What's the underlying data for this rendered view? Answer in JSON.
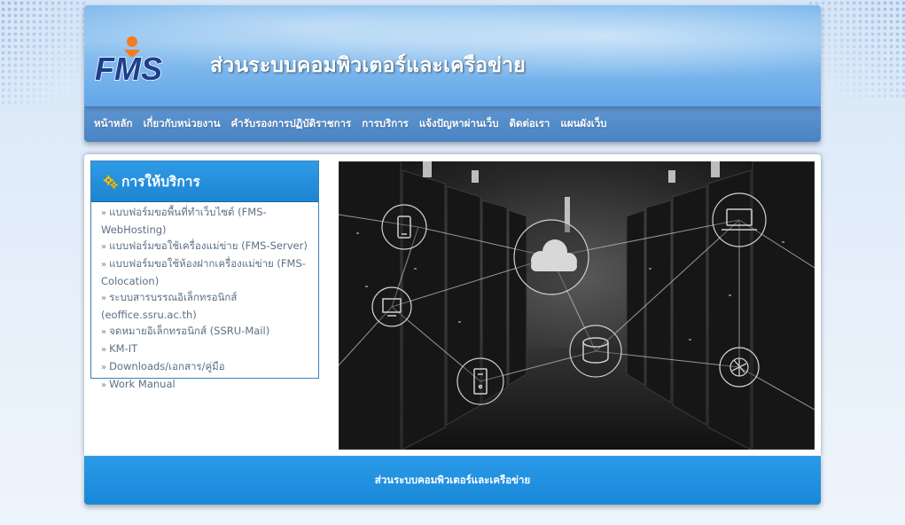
{
  "header": {
    "logo_text": "FMS",
    "title": "ส่วนระบบคอมพิวเตอร์และเครือข่าย"
  },
  "nav": {
    "items": [
      {
        "label": "หน้าหลัก"
      },
      {
        "label": "เกี่ยวกับหน่วยงาน"
      },
      {
        "label": "คำรับรองการปฏิบัติราชการ"
      },
      {
        "label": "การบริการ"
      },
      {
        "label": "แจ้งปัญหาผ่านเว็บ"
      },
      {
        "label": "ติดต่อเรา"
      },
      {
        "label": "แผนผังเว็บ"
      }
    ]
  },
  "services": {
    "title": "การให้บริการ",
    "icon": "gear-icon",
    "items": [
      {
        "label": "แบบฟอร์มขอพื้นที่ทำเว็บไซต์ (FMS-WebHosting)"
      },
      {
        "label": "แบบฟอร์มขอใช้เครื่องแม่ข่าย (FMS-Server)"
      },
      {
        "label": "แบบฟอร์มขอใช้ห้องฝากเครื่องแม่ข่าย (FMS-Colocation)"
      },
      {
        "label": "ระบบสารบรรณอิเล็กทรอนิกส์ (eoffice.ssru.ac.th)"
      },
      {
        "label": "จดหมายอิเล็กทรอนิกส์ (SSRU-Mail)"
      },
      {
        "label": "KM-IT"
      },
      {
        "label": "Downloads/เอกสาร/คู่มือ"
      },
      {
        "label": "Work Manual"
      }
    ]
  },
  "hero": {
    "icons": [
      "cloud-icon",
      "tablet-icon",
      "laptop-icon",
      "monitor-icon",
      "database-icon",
      "server-icon",
      "aperture-icon"
    ]
  },
  "footer": {
    "text": "ส่วนระบบคอมพิวเตอร์และเครือข่าย"
  },
  "colors": {
    "nav_bg": "#4a84c4",
    "accent_blue": "#1d84d2",
    "logo_blue": "#1d3f8c",
    "logo_orange": "#f47b20"
  }
}
